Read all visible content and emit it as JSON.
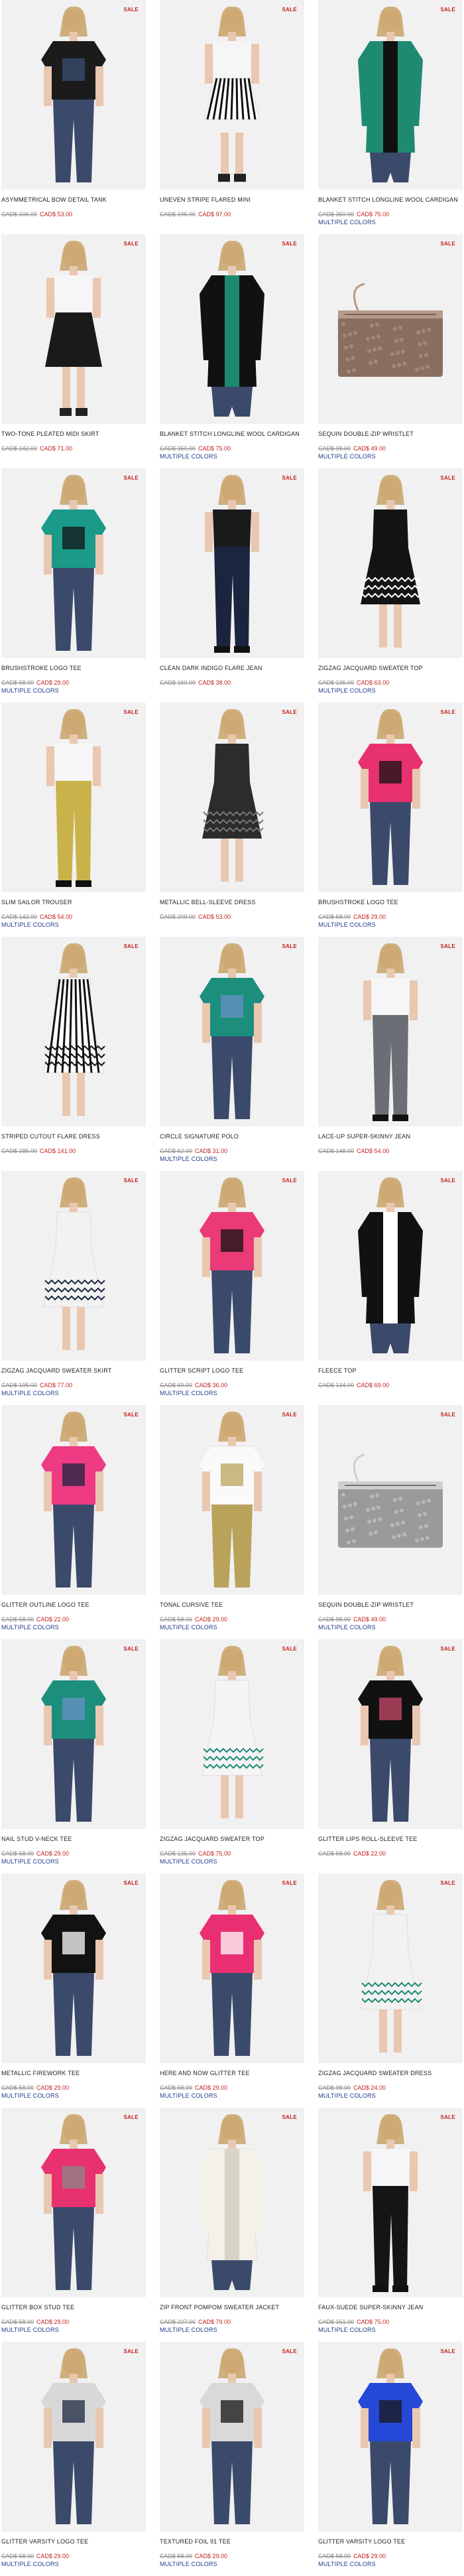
{
  "sale_label": "SALE",
  "multiple_colors_label": "MULTIPLE COLORS",
  "colors": {
    "sale_red": "#c41f1f",
    "link_blue": "#1e3a8a",
    "tile_bg": "#f1f1f1"
  },
  "products": [
    {
      "name": "ASYMMETRICAL BOW DETAIL TANK",
      "old": "CAD$ 106.00",
      "new": "CAD$ 53.00",
      "multi": false,
      "garment": "black-tank",
      "tone": "#1b1b1b",
      "accent": "#3a4f73"
    },
    {
      "name": "UNEVEN STRIPE FLARED MINI",
      "old": "CAD$ 195.00",
      "new": "CAD$ 97.00",
      "multi": false,
      "garment": "stripe-skirt",
      "tone": "#ffffff",
      "accent": "#111111"
    },
    {
      "name": "BLANKET STITCH LONGLINE WOOL CARDIGAN",
      "old": "CAD$ 350.00",
      "new": "CAD$ 75.00",
      "multi": true,
      "garment": "teal-cardigan",
      "tone": "#1f8a72",
      "accent": "#111111"
    },
    {
      "name": "TWO-TONE PLEATED MIDI SKIRT",
      "old": "CAD$ 142.00",
      "new": "CAD$ 71.00",
      "multi": false,
      "garment": "black-skirt",
      "tone": "#1a1a1a",
      "accent": "#6b3b2f"
    },
    {
      "name": "BLANKET STITCH LONGLINE WOOL CARDIGAN",
      "old": "CAD$ 350.00",
      "new": "CAD$ 75.00",
      "multi": true,
      "garment": "black-cardigan",
      "tone": "#111111",
      "accent": "#1f8a72"
    },
    {
      "name": "SEQUIN DOUBLE-ZIP WRISTLET",
      "old": "CAD$ 98.00",
      "new": "CAD$ 49.00",
      "multi": true,
      "garment": "bronze-wristlet",
      "tone": "#8a6f60",
      "accent": "#b89a88"
    },
    {
      "name": "BRUSHSTROKE LOGO TEE",
      "old": "CAD$ 58.00",
      "new": "CAD$ 29.00",
      "multi": true,
      "garment": "teal-tee",
      "tone": "#1b9a8a",
      "accent": "#111111"
    },
    {
      "name": "CLEAN DARK INDIGO FLARE JEAN",
      "old": "CAD$ 160.00",
      "new": "CAD$ 38.00",
      "multi": false,
      "garment": "indigo-jean",
      "tone": "#1b2540",
      "accent": "#f2f2f2"
    },
    {
      "name": "ZIGZAG JACQUARD SWEATER TOP",
      "old": "CAD$ 135.00",
      "new": "CAD$ 63.00",
      "multi": true,
      "garment": "black-dress",
      "tone": "#141414",
      "accent": "#ffffff"
    },
    {
      "name": "SLIM SAILOR TROUSER",
      "old": "CAD$ 142.00",
      "new": "CAD$ 54.00",
      "multi": true,
      "garment": "mustard-trouser",
      "tone": "#c9b24a",
      "accent": "#ffffff"
    },
    {
      "name": "METALLIC BELL-SLEEVE DRESS",
      "old": "CAD$ 209.00",
      "new": "CAD$ 53.00",
      "multi": false,
      "garment": "metallic-dress",
      "tone": "#2c2c2c",
      "accent": "#777777"
    },
    {
      "name": "BRUSHSTROKE LOGO TEE",
      "old": "CAD$ 58.00",
      "new": "CAD$ 29.00",
      "multi": true,
      "garment": "pink-tee",
      "tone": "#e8316f",
      "accent": "#111111"
    },
    {
      "name": "STRIPED CUTOUT FLARE DRESS",
      "old": "CAD$ 285.00",
      "new": "CAD$ 141.00",
      "multi": false,
      "garment": "stripe-dress",
      "tone": "#ffffff",
      "accent": "#111111"
    },
    {
      "name": "CIRCLE SIGNATURE POLO",
      "old": "CAD$ 62.00",
      "new": "CAD$ 31.00",
      "multi": true,
      "garment": "teal-polo",
      "tone": "#1b8f7c",
      "accent": "#6a8fc4"
    },
    {
      "name": "LACE-UP SUPER-SKINNY JEAN",
      "old": "CAD$ 148.00",
      "new": "CAD$ 54.00",
      "multi": false,
      "garment": "grey-jean",
      "tone": "#6b6f75",
      "accent": "#7fa3d6"
    },
    {
      "name": "ZIGZAG JACQUARD SWEATER SKIRT",
      "old": "CAD$ 195.00",
      "new": "CAD$ 77.00",
      "multi": true,
      "garment": "white-skirt",
      "tone": "#f2f2f2",
      "accent": "#1b2540"
    },
    {
      "name": "GLITTER SCRIPT LOGO TEE",
      "old": "CAD$ 69.00",
      "new": "CAD$ 36.00",
      "multi": true,
      "garment": "pink-script-tee",
      "tone": "#ea3a78",
      "accent": "#111111"
    },
    {
      "name": "FLEECE TOP",
      "old": "CAD$ 134.00",
      "new": "CAD$ 69.00",
      "multi": false,
      "garment": "fleece",
      "tone": "#111111",
      "accent": "#ffffff"
    },
    {
      "name": "GLITTER OUTLINE LOGO TEE",
      "old": "CAD$ 58.00",
      "new": "CAD$ 22.00",
      "multi": true,
      "garment": "pink-outline-tee",
      "tone": "#ee3b83",
      "accent": "#1b2540"
    },
    {
      "name": "TONAL CURSIVE TEE",
      "old": "CAD$ 58.00",
      "new": "CAD$ 29.00",
      "multi": true,
      "garment": "white-tee",
      "tone": "#fafafa",
      "accent": "#b9a35b"
    },
    {
      "name": "SEQUIN DOUBLE-ZIP WRISTLET",
      "old": "CAD$ 98.00",
      "new": "CAD$ 49.00",
      "multi": true,
      "garment": "silver-wristlet",
      "tone": "#9a9a9a",
      "accent": "#cfcfcf"
    },
    {
      "name": "NAIL STUD V-NECK TEE",
      "old": "CAD$ 58.00",
      "new": "CAD$ 29.00",
      "multi": true,
      "garment": "teal-vneck",
      "tone": "#1b8f7c",
      "accent": "#6a8fc4"
    },
    {
      "name": "ZIGZAG JACQUARD SWEATER TOP",
      "old": "CAD$ 135.00",
      "new": "CAD$ 75.00",
      "multi": true,
      "garment": "white-sweater",
      "tone": "#f5f5f5",
      "accent": "#1f8a72"
    },
    {
      "name": "GLITTER LIPS ROLL-SLEEVE TEE",
      "old": "CAD$ 58.00",
      "new": "CAD$ 22.00",
      "multi": false,
      "garment": "black-lips-tee",
      "tone": "#111111",
      "accent": "#c84a6a"
    },
    {
      "name": "METALLIC FIREWORK TEE",
      "old": "CAD$ 58.00",
      "new": "CAD$ 29.00",
      "multi": true,
      "garment": "black-firework-tee",
      "tone": "#121212",
      "accent": "#ffffff"
    },
    {
      "name": "HERE AND NOW GLITTER TEE",
      "old": "CAD$ 58.00",
      "new": "CAD$ 29.00",
      "multi": true,
      "garment": "pink-here-tee",
      "tone": "#ea2f72",
      "accent": "#ffffff"
    },
    {
      "name": "ZIGZAG JACQUARD SWEATER DRESS",
      "old": "CAD$ 98.00",
      "new": "CAD$ 24.00",
      "multi": true,
      "garment": "white-jacquard-dress",
      "tone": "#f2f2f2",
      "accent": "#1f8a72"
    },
    {
      "name": "GLITTER BOX STUD TEE",
      "old": "CAD$ 58.00",
      "new": "CAD$ 29.00",
      "multi": true,
      "garment": "pink-box-tee",
      "tone": "#e8316f",
      "accent": "#888888"
    },
    {
      "name": "ZIP FRONT POMPOM SWEATER JACKET",
      "old": "CAD$ 227.00",
      "new": "CAD$ 79.00",
      "multi": true,
      "garment": "cream-jacket",
      "tone": "#f4f1ea",
      "accent": "#d9d4c8"
    },
    {
      "name": "FAUX-SUEDE SUPER-SKINNY JEAN",
      "old": "CAD$ 151.00",
      "new": "CAD$ 75.00",
      "multi": true,
      "garment": "black-faux-jean",
      "tone": "#151515",
      "accent": "#e8e8e8"
    },
    {
      "name": "GLITTER VARSITY LOGO TEE",
      "old": "CAD$ 58.00",
      "new": "CAD$ 29.00",
      "multi": true,
      "garment": "grey-varsity-tee",
      "tone": "#d8d8d8",
      "accent": "#1b2540"
    },
    {
      "name": "TEXTURED FOIL 91 TEE",
      "old": "CAD$ 58.00",
      "new": "CAD$ 29.00",
      "multi": true,
      "garment": "grey-foil-tee",
      "tone": "#d9d9d9",
      "accent": "#111111"
    },
    {
      "name": "GLITTER VARSITY LOGO TEE",
      "old": "CAD$ 58.00",
      "new": "CAD$ 29.00",
      "multi": true,
      "garment": "blue-varsity-tee",
      "tone": "#2648d6",
      "accent": "#1a1a1a"
    }
  ]
}
